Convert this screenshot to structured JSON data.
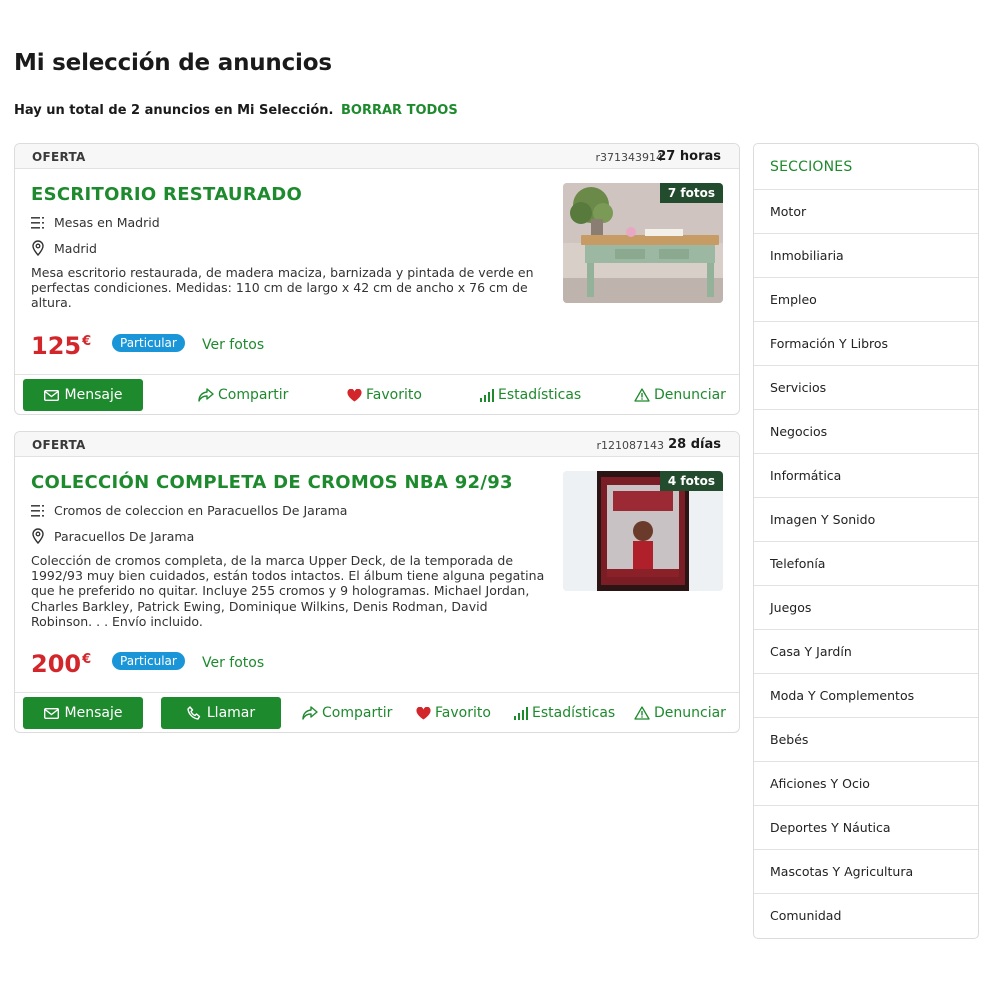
{
  "page": {
    "title": "Mi selección de anuncios",
    "summary_text": "Hay un total de 2 anuncios en Mi Selección.",
    "clear_all_label": "BORRAR TODOS"
  },
  "colors": {
    "accent": "#1e8a2e",
    "price": "#d3262b",
    "badge": "#1a96d8"
  },
  "ads": [
    {
      "type": "OFERTA",
      "ref": "r371343914",
      "age": "27 horas",
      "title": "ESCRITORIO RESTAURADO",
      "category": "Mesas en Madrid",
      "location": "Madrid",
      "description": "Mesa escritorio restaurada, de madera maciza, barnizada y pintada de verde en perfectas condiciones. Medidas: 110 cm de largo x 42 cm de ancho x 76 cm de altura.",
      "price": "125",
      "currency": "€",
      "seller_type": "Particular",
      "see_photos": "Ver fotos",
      "photo_count": "7 fotos",
      "actions": {
        "message": "Mensaje",
        "share": "Compartir",
        "favorite": "Favorito",
        "stats": "Estadísticas",
        "report": "Denunciar"
      }
    },
    {
      "type": "OFERTA",
      "ref": "r121087143",
      "age": "28 días",
      "title": "COLECCIÓN COMPLETA DE CROMOS NBA 92/93",
      "category": "Cromos de coleccion en Paracuellos De Jarama",
      "location": "Paracuellos De Jarama",
      "description": "Colección de cromos completa, de la marca Upper Deck, de la temporada de 1992/93 muy bien cuidados, están todos intactos. El álbum tiene alguna pegatina que he preferido no quitar. Incluye 255 cromos y 9 hologramas. Michael Jordan, Charles Barkley, Patrick Ewing, Dominique Wilkins, Denis Rodman, David Robinson. . . Envío incluido.",
      "price": "200",
      "currency": "€",
      "seller_type": "Particular",
      "see_photos": "Ver fotos",
      "photo_count": "4 fotos",
      "actions": {
        "message": "Mensaje",
        "call": "Llamar",
        "share": "Compartir",
        "favorite": "Favorito",
        "stats": "Estadísticas",
        "report": "Denunciar"
      }
    }
  ],
  "sidebar": {
    "title": "SECCIONES",
    "items": [
      "Motor",
      "Inmobiliaria",
      "Empleo",
      "Formación Y Libros",
      "Servicios",
      "Negocios",
      "Informática",
      "Imagen Y Sonido",
      "Telefonía",
      "Juegos",
      "Casa Y Jardín",
      "Moda Y Complementos",
      "Bebés",
      "Aficiones Y Ocio",
      "Deportes Y Náutica",
      "Mascotas Y Agricultura",
      "Comunidad"
    ]
  }
}
